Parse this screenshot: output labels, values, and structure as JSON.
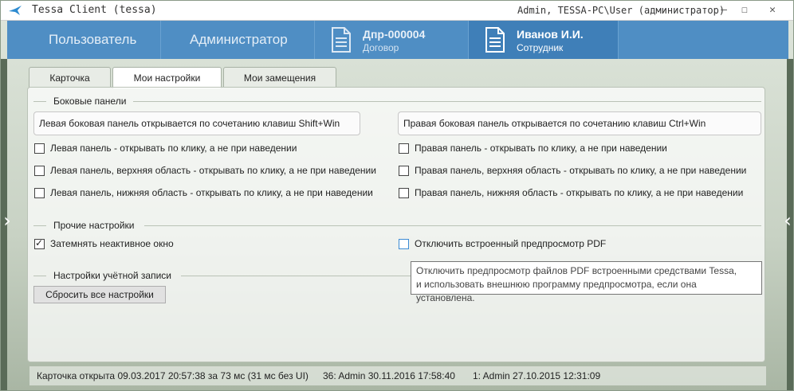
{
  "titlebar": {
    "app_title": "Tessa Client (tessa)",
    "user_info": "Admin, TESSA-PC\\User (администратор)",
    "minimize": "—",
    "maximize": "☐",
    "close": "✕"
  },
  "navbar": {
    "tab_user": "Пользователь",
    "tab_admin": "Администратор",
    "doc1": {
      "title": "Дпр-000004",
      "subtitle": "Договор",
      "icon": "document-icon"
    },
    "doc2": {
      "title": "Иванов И.И.",
      "subtitle": "Сотрудник",
      "icon": "document-icon"
    }
  },
  "tabs": [
    "Карточка",
    "Мои настройки",
    "Мои замещения"
  ],
  "active_tab": "Мои настройки",
  "side_panels": {
    "heading": "Боковые панели",
    "left_info": "Левая боковая панель открывается по сочетанию клавиш Shift+Win",
    "right_info": "Правая боковая панель открывается по сочетанию клавиш Ctrl+Win",
    "left_options": [
      "Левая панель - открывать по клику, а не при наведении",
      "Левая панель, верхняя область - открывать по клику, а не при наведении",
      "Левая панель, нижняя область - открывать по клику, а не при наведении"
    ],
    "right_options": [
      "Правая панель - открывать по клику, а не при наведении",
      "Правая панель, верхняя область - открывать по клику, а не при наведении",
      "Правая панель, нижняя область - открывать по клику, а не при наведении"
    ]
  },
  "other_settings": {
    "heading": "Прочие настройки",
    "dim_inactive": "Затемнять неактивное окно",
    "disable_pdf": "Отключить встроенный предпросмотр PDF"
  },
  "account": {
    "heading": "Настройки учётной записи",
    "reset_button": "Сбросить все настройки"
  },
  "tooltip": {
    "line1": "Отключить предпросмотр файлов PDF встроенными средствами Tessa,",
    "line2": "и использовать внешнюю программу предпросмотра, если она установлена."
  },
  "statusbar": {
    "opened": "Карточка открыта 09.03.2017 20:57:38 за 73 мс (31 мс без UI)",
    "version1": "36:  Admin  30.11.2016 17:58:40",
    "version2": "1:  Admin  27.10.2015 12:31:09"
  },
  "colors": {
    "nav_bg": "#4f8ec4",
    "nav_active": "#3f7fb8",
    "focus_border": "#3c8bd4"
  }
}
